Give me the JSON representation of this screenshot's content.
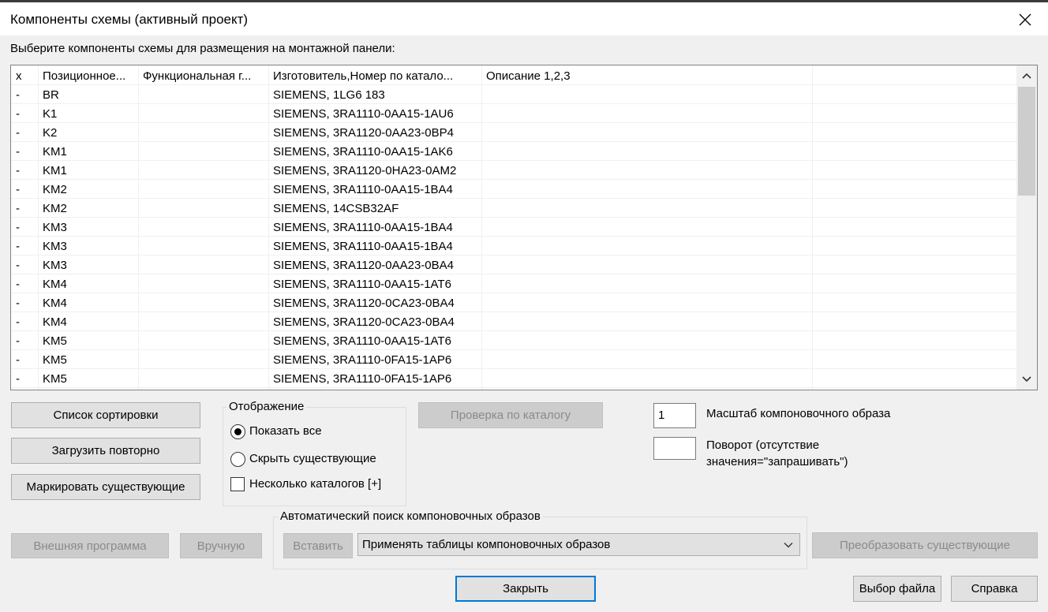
{
  "window": {
    "title": "Компоненты схемы (активный проект)"
  },
  "instruction": "Выберите компоненты схемы для размещения на монтажной панели:",
  "table": {
    "columns": [
      "x",
      "Позиционное...",
      "Функциональная г...",
      "Изготовитель,Номер по катало...",
      "Описание 1,2,3",
      ""
    ],
    "rows": [
      {
        "x": "-",
        "pos": "BR",
        "func": "",
        "mfr": "SIEMENS, 1LG6 183",
        "desc": ""
      },
      {
        "x": "-",
        "pos": "K1",
        "func": "",
        "mfr": "SIEMENS, 3RA1110-0AA15-1AU6",
        "desc": ""
      },
      {
        "x": "-",
        "pos": "K2",
        "func": "",
        "mfr": "SIEMENS, 3RA1120-0AA23-0BP4",
        "desc": ""
      },
      {
        "x": "-",
        "pos": "KM1",
        "func": "",
        "mfr": "SIEMENS, 3RA1110-0AA15-1AK6",
        "desc": ""
      },
      {
        "x": "-",
        "pos": "KM1",
        "func": "",
        "mfr": "SIEMENS, 3RA1120-0HA23-0AM2",
        "desc": ""
      },
      {
        "x": "-",
        "pos": "KM2",
        "func": "",
        "mfr": "SIEMENS, 3RA1110-0AA15-1BA4",
        "desc": ""
      },
      {
        "x": "-",
        "pos": "KM2",
        "func": "",
        "mfr": "SIEMENS, 14CSB32AF",
        "desc": ""
      },
      {
        "x": "-",
        "pos": "KM3",
        "func": "",
        "mfr": "SIEMENS, 3RA1110-0AA15-1BA4",
        "desc": ""
      },
      {
        "x": "-",
        "pos": "KM3",
        "func": "",
        "mfr": "SIEMENS, 3RA1110-0AA15-1BA4",
        "desc": ""
      },
      {
        "x": "-",
        "pos": "KM3",
        "func": "",
        "mfr": "SIEMENS, 3RA1120-0AA23-0BA4",
        "desc": ""
      },
      {
        "x": "-",
        "pos": "KM4",
        "func": "",
        "mfr": "SIEMENS, 3RA1110-0AA15-1AT6",
        "desc": ""
      },
      {
        "x": "-",
        "pos": "KM4",
        "func": "",
        "mfr": "SIEMENS, 3RA1120-0CA23-0BA4",
        "desc": ""
      },
      {
        "x": "-",
        "pos": "KM4",
        "func": "",
        "mfr": "SIEMENS, 3RA1120-0CA23-0BA4",
        "desc": ""
      },
      {
        "x": "-",
        "pos": "KM5",
        "func": "",
        "mfr": "SIEMENS, 3RA1110-0AA15-1AT6",
        "desc": ""
      },
      {
        "x": "-",
        "pos": "KM5",
        "func": "",
        "mfr": "SIEMENS, 3RA1110-0FA15-1AP6",
        "desc": ""
      },
      {
        "x": "-",
        "pos": "KM5",
        "func": "",
        "mfr": "SIEMENS, 3RA1110-0FA15-1AP6",
        "desc": ""
      }
    ]
  },
  "buttons": {
    "sort_list": "Список сортировки",
    "reload": "Загрузить повторно",
    "mark_existing": "Маркировать существующие",
    "catalog_check": "Проверка по каталогу",
    "external_program": "Внешняя программа",
    "manual": "Вручную",
    "insert": "Вставить",
    "convert_existing": "Преобразовать существующие",
    "close": "Закрыть",
    "select_file": "Выбор файла",
    "help": "Справка"
  },
  "display_group": {
    "title": "Отображение",
    "show_all": "Показать все",
    "hide_existing": "Скрыть существующие",
    "multiple_catalogs": "Несколько каталогов [+]",
    "selected": "show_all",
    "multiple_catalogs_checked": false
  },
  "scale": {
    "value": "1",
    "label": "Масштаб компоновочного образа"
  },
  "rotation": {
    "value": "",
    "label_line1": "Поворот (отсутствие",
    "label_line2": "значения=\"запрашивать\")"
  },
  "auto_search": {
    "title": "Автоматический поиск компоновочных образов",
    "selected_option": "Применять таблицы компоновочных образов"
  },
  "icons": {
    "close": "close-icon",
    "scroll_up": "chevron-up-icon",
    "scroll_down": "chevron-down-icon",
    "dropdown": "chevron-down-icon"
  }
}
